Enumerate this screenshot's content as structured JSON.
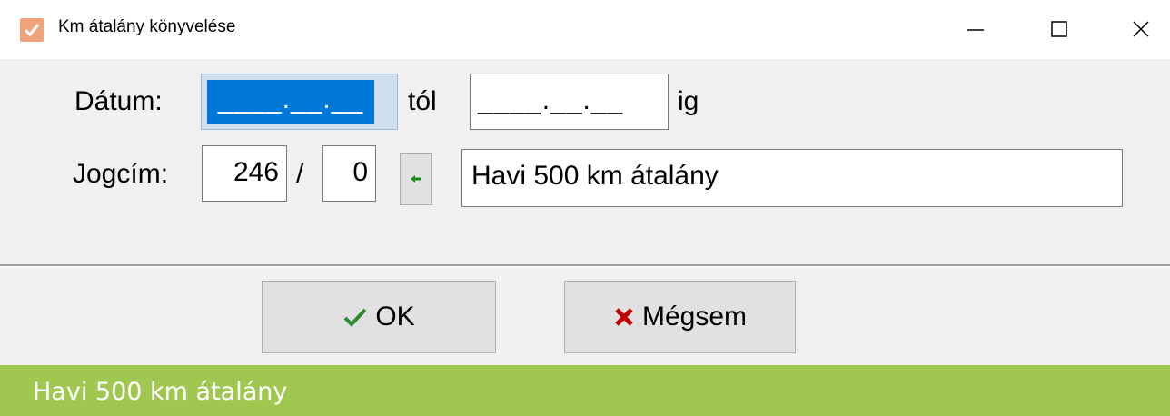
{
  "window": {
    "title": "Km átalány könyvelése",
    "icon": "checkmark-app-icon",
    "controls": [
      "minimize-icon",
      "maximize-icon",
      "close-icon"
    ]
  },
  "form": {
    "datum_label": "Dátum:",
    "date_from_value": "____.__.__",
    "tol_label": "tól",
    "date_to_value": "____.__.__",
    "ig_label": "ig",
    "jogcim_label": "Jogcím:",
    "jogcim_main": "246",
    "separator": "/",
    "jogcim_sub": "0",
    "pick_icon": "arrow-left-icon",
    "description": "Havi 500 km átalány"
  },
  "buttons": {
    "ok_label": "OK",
    "cancel_label": "Mégsem"
  },
  "footer": {
    "caption": "Havi 500 km átalány"
  },
  "colors": {
    "selection": "#0078d7",
    "ok_check": "#2e8b2e",
    "cancel_x": "#c00000",
    "footer_bg": "#a0c851"
  }
}
